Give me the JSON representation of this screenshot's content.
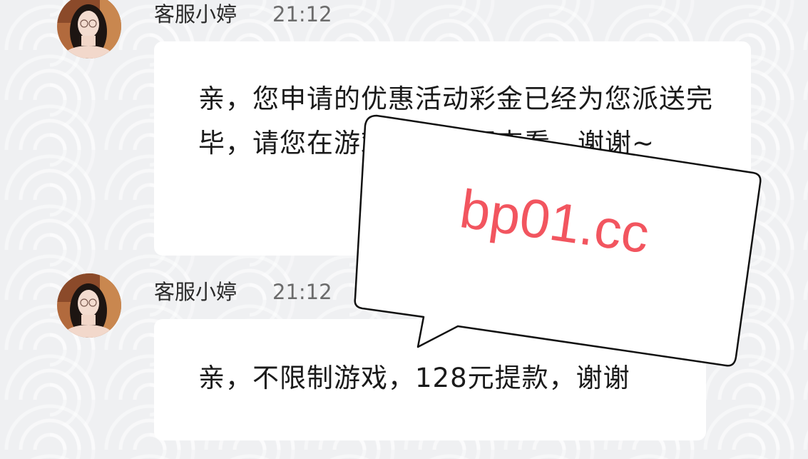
{
  "messages": [
    {
      "sender": "客服小婷",
      "time": "21:12",
      "text": "亲，您申请的优惠活动彩金已经为您派送完毕，请您在游戏页面进行查看。谢谢~"
    },
    {
      "sender": "客服小婷",
      "time": "21:12",
      "text": "亲，不限制游戏，128元提款，谢谢"
    }
  ],
  "overlay_sticker": {
    "text": "bp01.cc",
    "color": "#f2555f"
  }
}
